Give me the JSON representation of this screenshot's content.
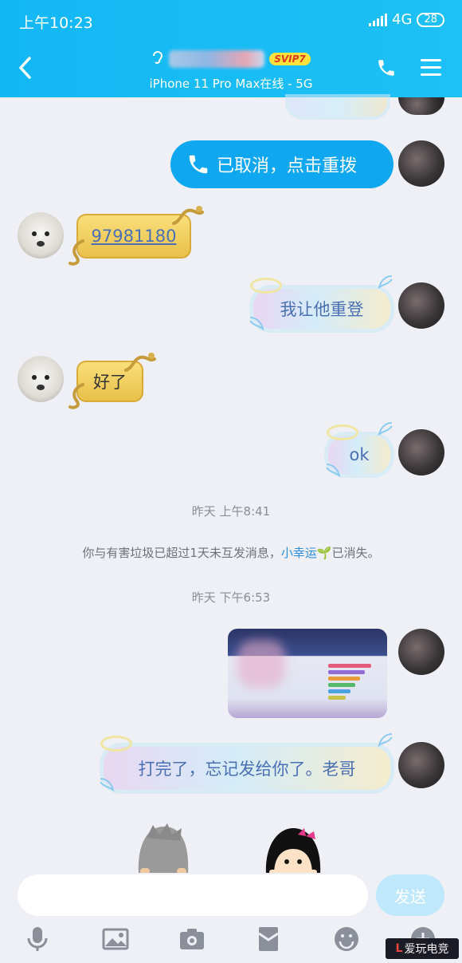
{
  "status_bar": {
    "time": "上午10:23",
    "network": "4G",
    "battery": "28"
  },
  "header": {
    "title_badge": "SVIP7",
    "subtitle": "iPhone 11 Pro Max在线 - 5G"
  },
  "messages": {
    "call": "已取消，点击重拨",
    "number": "97981180",
    "relogin": "我让他重登",
    "done": "好了",
    "ok": "ok",
    "time1": "昨天 上午8:41",
    "system_before": "你与有害垃圾已超过1天未互发消息，",
    "system_link": "小幸运",
    "system_sprout": "🌱",
    "system_after": "已消失。",
    "time2": "昨天 下午6:53",
    "final": "打完了，忘记发给你了。老哥"
  },
  "input": {
    "placeholder": "",
    "send_label": "发送"
  },
  "toolbar": [
    "microphone-icon",
    "image-icon",
    "camera-icon",
    "red-packet-icon",
    "emoji-icon",
    "plus-icon"
  ],
  "watermark": {
    "text": "爱玩电竞"
  },
  "colors": {
    "header": "#12b7f5",
    "call_bubble": "#0fa7ef",
    "send_button": "#bfe8fc"
  }
}
